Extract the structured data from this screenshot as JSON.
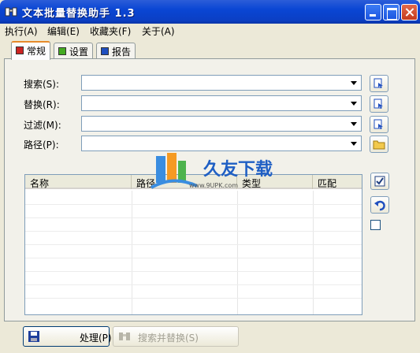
{
  "window": {
    "title": "文本批量替换助手 1.3"
  },
  "menu": {
    "items": [
      "执行(A)",
      "编辑(E)",
      "收藏夹(F)",
      "关于(A)"
    ]
  },
  "tabs": [
    {
      "label": "常规",
      "icon_color": "#cc2222"
    },
    {
      "label": "设置",
      "icon_color": "#44aa22"
    },
    {
      "label": "报告",
      "icon_color": "#1f4fbf"
    }
  ],
  "form": {
    "search_label": "搜索(S):",
    "replace_label": "替换(R):",
    "filter_label": "过滤(M):",
    "path_label": "路径(P):",
    "search_value": "",
    "replace_value": "",
    "filter_value": "",
    "path_value": ""
  },
  "list": {
    "columns": [
      "名称",
      "路径",
      "类型",
      "匹配"
    ]
  },
  "watermark": {
    "text": "久友下载",
    "subtext": "www.9UPK.com"
  },
  "buttons": {
    "process": "处理(P)",
    "search_replace": "搜索并替换(S)"
  },
  "colors": {
    "titlebar": "#0a46d4",
    "tab_active_accent": "#e68b2c",
    "window_bg": "#ece9d8"
  }
}
